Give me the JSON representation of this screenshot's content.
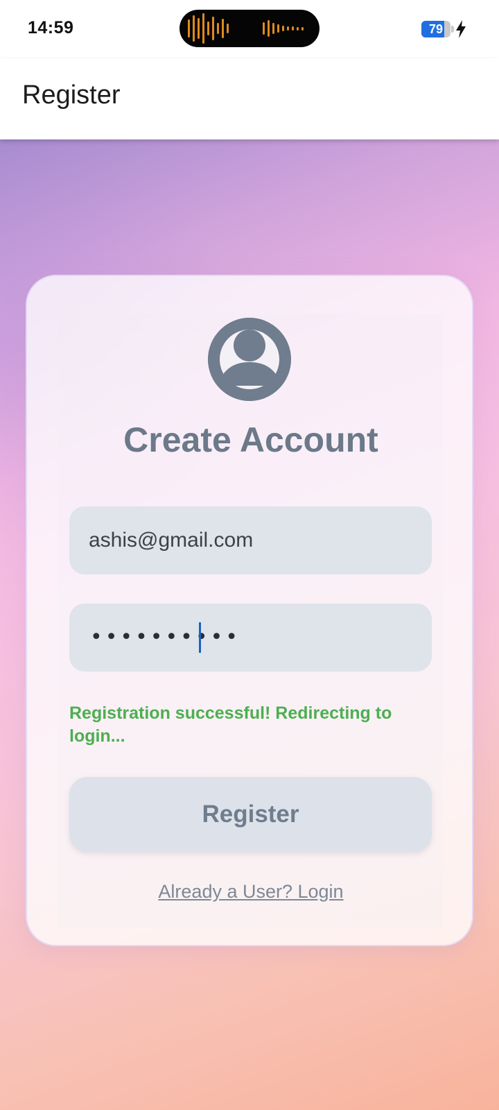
{
  "status_bar": {
    "time": "14:59",
    "battery_level": "79",
    "battery_fraction": 0.79,
    "charging_icon": "lightning-bolt-icon",
    "island_icon": "audio-waveform-icon",
    "wave_color": "#e08a1c"
  },
  "app_bar": {
    "title": "Register"
  },
  "card": {
    "avatar_icon": "account-circle-icon",
    "title": "Create Account",
    "email_value": "ashis@gmail.com",
    "password_mask": "••••••••••",
    "success_message": "Registration successful! Redirecting to login...",
    "register_label": "Register",
    "login_link": "Already a User? Login"
  },
  "colors": {
    "success": "#4caf50",
    "field_bg": "#dfe3ea",
    "text_muted": "#6b7989",
    "caret": "#1565c0",
    "battery": "#1f6fe0"
  }
}
